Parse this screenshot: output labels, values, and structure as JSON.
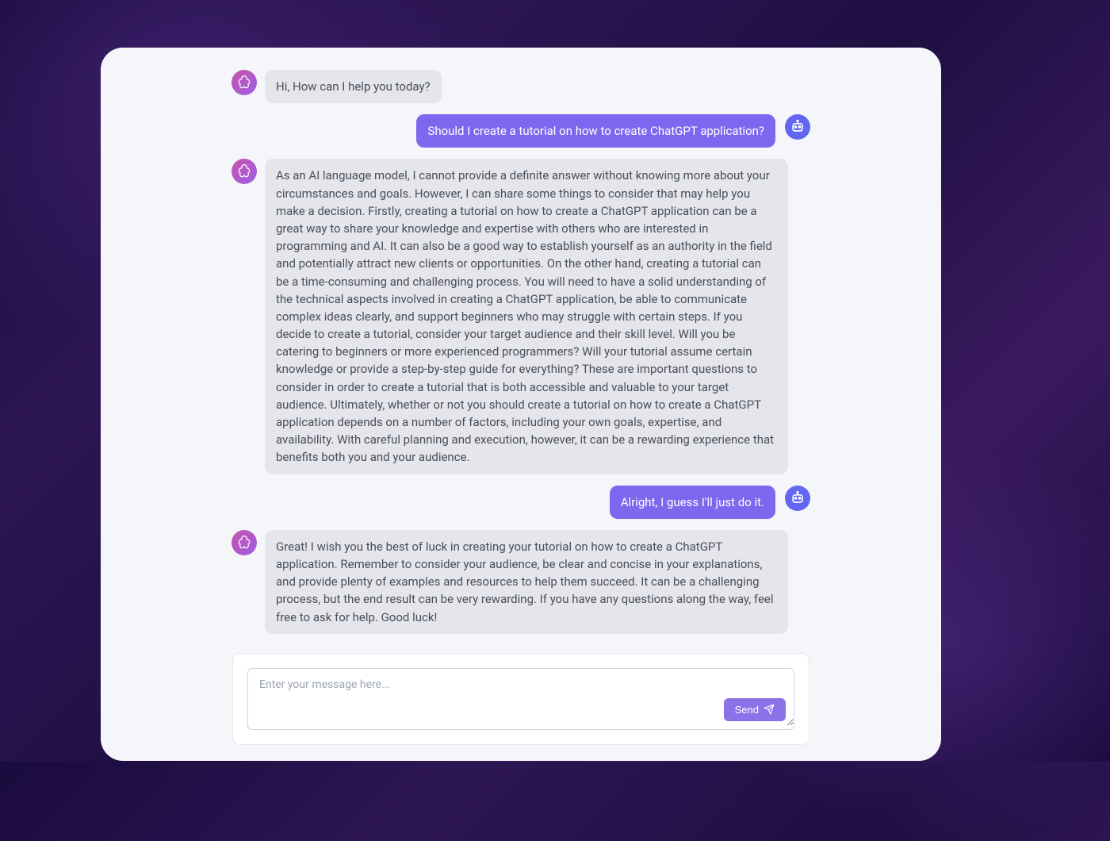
{
  "messages": [
    {
      "role": "bot",
      "text": "Hi, How can I help you today?"
    },
    {
      "role": "user",
      "text": "Should I create a tutorial on how to create ChatGPT application?"
    },
    {
      "role": "bot",
      "text": "As an AI language model, I cannot provide a definite answer without knowing more about your circumstances and goals. However, I can share some things to consider that may help you make a decision. Firstly, creating a tutorial on how to create a ChatGPT application can be a great way to share your knowledge and expertise with others who are interested in programming and AI. It can also be a good way to establish yourself as an authority in the field and potentially attract new clients or opportunities. On the other hand, creating a tutorial can be a time-consuming and challenging process. You will need to have a solid understanding of the technical aspects involved in creating a ChatGPT application, be able to communicate complex ideas clearly, and support beginners who may struggle with certain steps. If you decide to create a tutorial, consider your target audience and their skill level. Will you be catering to beginners or more experienced programmers? Will your tutorial assume certain knowledge or provide a step-by-step guide for everything? These are important questions to consider in order to create a tutorial that is both accessible and valuable to your target audience. Ultimately, whether or not you should create a tutorial on how to create a ChatGPT application depends on a number of factors, including your own goals, expertise, and availability. With careful planning and execution, however, it can be a rewarding experience that benefits both you and your audience."
    },
    {
      "role": "user",
      "text": "Alright, I guess I'll just do it."
    },
    {
      "role": "bot",
      "text": "Great! I wish you the best of luck in creating your tutorial on how to create a ChatGPT application. Remember to consider your audience, be clear and concise in your explanations, and provide plenty of examples and resources to help them succeed. It can be a challenging process, but the end result can be very rewarding. If you have any questions along the way, feel free to ask for help. Good luck!"
    }
  ],
  "input": {
    "placeholder": "Enter your message here...",
    "send_label": "Send"
  }
}
